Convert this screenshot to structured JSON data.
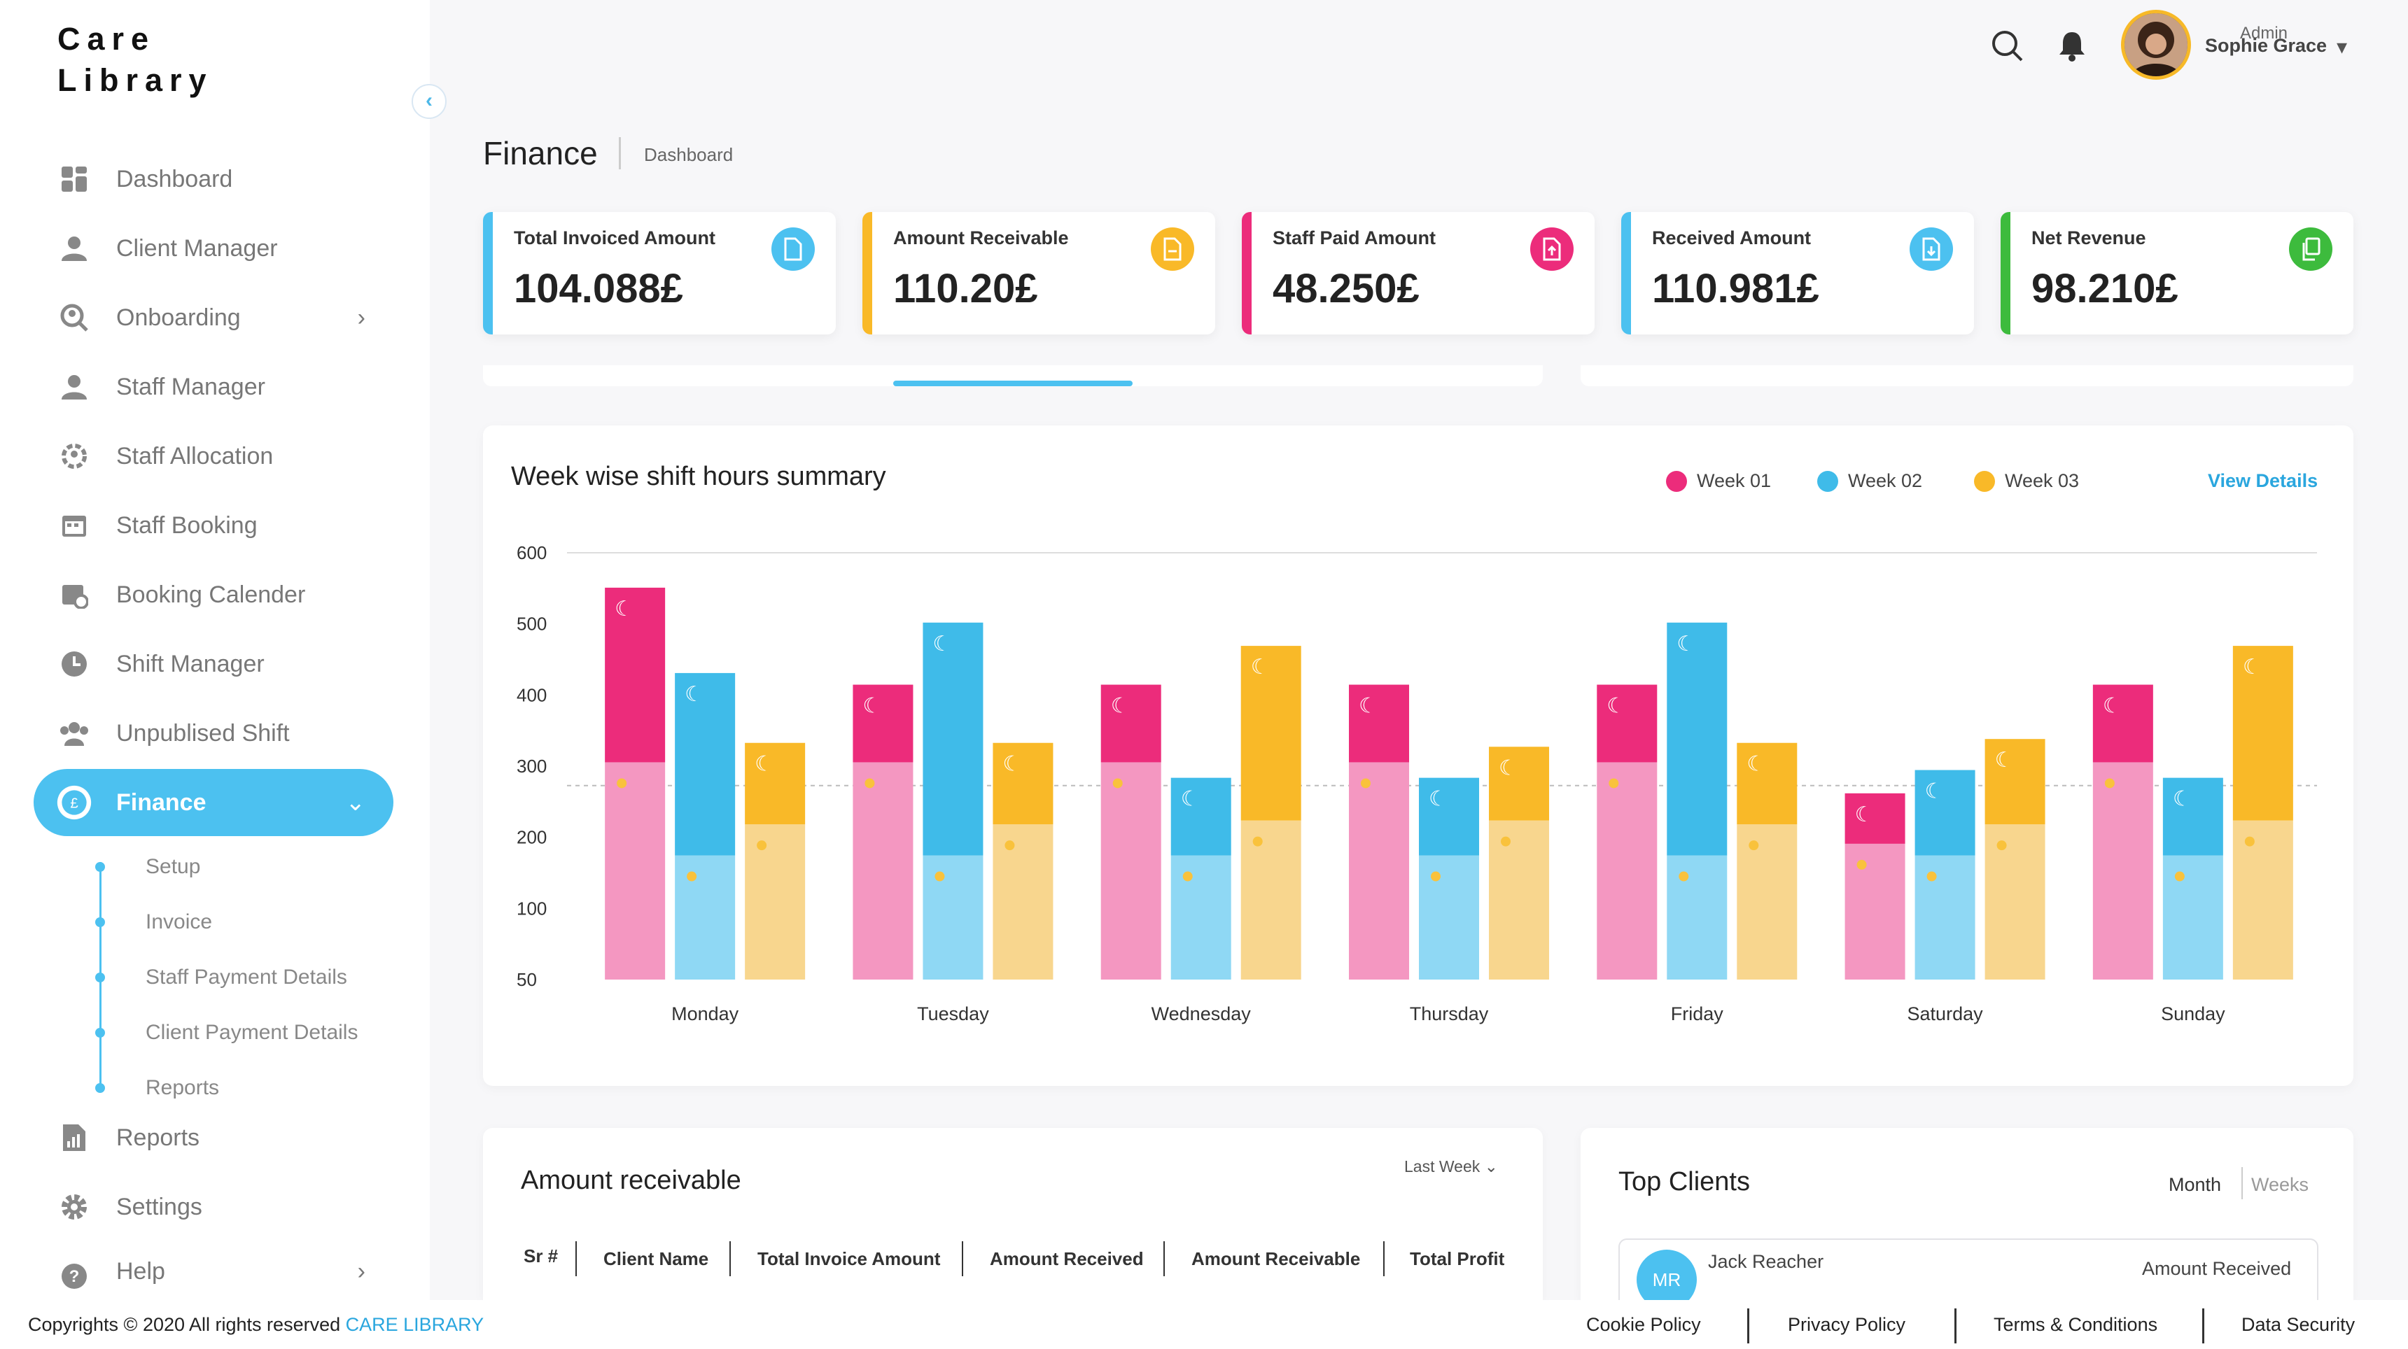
{
  "app": {
    "logo_line1": "Care",
    "logo_line2": "Library"
  },
  "sidebar": {
    "items": [
      {
        "label": "Dashboard"
      },
      {
        "label": "Client Manager"
      },
      {
        "label": "Onboarding",
        "chevron": "›"
      },
      {
        "label": "Staff Manager"
      },
      {
        "label": "Staff Allocation"
      },
      {
        "label": "Staff Booking"
      },
      {
        "label": "Booking Calender"
      },
      {
        "label": "Shift Manager"
      },
      {
        "label": "Unpublised Shift"
      },
      {
        "label": "Finance",
        "chevron": "⌄"
      },
      {
        "label": "Reports"
      },
      {
        "label": "Settings"
      },
      {
        "label": "Help",
        "chevron": "›"
      }
    ],
    "sub_items": [
      {
        "label": "Setup"
      },
      {
        "label": "Invoice"
      },
      {
        "label": "Staff Payment Details"
      },
      {
        "label": "Client Payment Details"
      },
      {
        "label": "Reports"
      }
    ],
    "collapse_icon": "‹"
  },
  "header": {
    "role": "Admin",
    "user_name": "Sophie Grace",
    "dropdown": "▾",
    "icons": [
      "search-icon",
      "bell-icon"
    ]
  },
  "page": {
    "title": "Finance",
    "breadcrumb": "Dashboard"
  },
  "stats": [
    {
      "label": "Total Invoiced Amount",
      "value": "104.088£",
      "color": "#4cc1f0"
    },
    {
      "label": "Amount Receivable",
      "value": "110.20£",
      "color": "#f9b928"
    },
    {
      "label": "Staff Paid Amount",
      "value": "48.250£",
      "color": "#ec2c7b"
    },
    {
      "label": "Received Amount",
      "value": "110.981£",
      "color": "#4cc1f0"
    },
    {
      "label": "Net Revenue",
      "value": "98.210£",
      "color": "#3dbb3d"
    }
  ],
  "chart_data": {
    "type": "bar",
    "title": "Week wise shift hours summary",
    "view_details": "View Details",
    "categories": [
      "Monday",
      "Tuesday",
      "Wednesday",
      "Thursday",
      "Friday",
      "Saturday",
      "Sunday"
    ],
    "y_ticks": [
      600,
      500,
      400,
      300,
      200,
      100,
      50
    ],
    "ylim": [
      50,
      600
    ],
    "reference_line": 300,
    "series": [
      {
        "name": "Week 01",
        "color": "#ec2c7b",
        "light": "#f497c1",
        "values": [
          555,
          430,
          430,
          430,
          430,
          290,
          430
        ],
        "split": [
          330,
          330,
          330,
          330,
          330,
          225,
          330
        ]
      },
      {
        "name": "Week 02",
        "color": "#3fbbe9",
        "light": "#8fd8f4",
        "values": [
          445,
          510,
          310,
          310,
          510,
          320,
          310
        ],
        "split": [
          210,
          210,
          210,
          210,
          210,
          210,
          210
        ]
      },
      {
        "name": "Week 03",
        "color": "#f9b928",
        "light": "#f8d68e",
        "values": [
          355,
          355,
          480,
          350,
          355,
          360,
          480
        ],
        "split": [
          250,
          250,
          255,
          255,
          250,
          250,
          255
        ]
      }
    ]
  },
  "amount_receivable": {
    "title": "Amount receivable",
    "filter": "Last Week",
    "filter_chevron": "⌄",
    "columns": [
      "Sr #",
      "Client Name",
      "Total Invoice Amount",
      "Amount Received",
      "Amount Receivable",
      "Total Profit"
    ]
  },
  "top_clients": {
    "title": "Top Clients",
    "tabs": [
      "Month",
      "Weeks"
    ],
    "client_initials": "MR",
    "client_name": "Jack Reacher",
    "column": "Amount Received"
  },
  "footer": {
    "copyright": "Copyrights © 2020  All rights reserved",
    "brand": "CARE LIBRARY",
    "links": [
      "Cookie Policy",
      "Privacy Policy",
      "Terms & Conditions",
      "Data Security"
    ]
  }
}
